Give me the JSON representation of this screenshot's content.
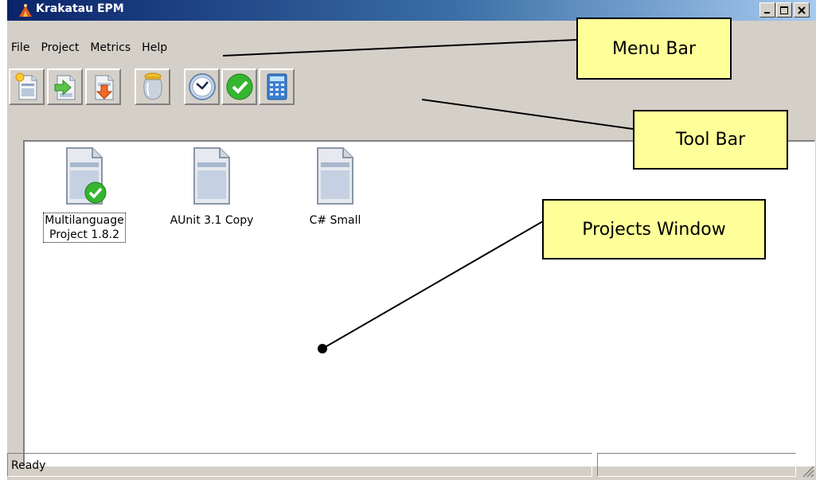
{
  "window": {
    "title": "Krakatau EPM"
  },
  "menubar": {
    "items": [
      {
        "label": "File"
      },
      {
        "label": "Project"
      },
      {
        "label": "Metrics"
      },
      {
        "label": "Help"
      }
    ]
  },
  "toolbar": {
    "buttons": [
      {
        "icon": "new-project-icon"
      },
      {
        "icon": "import-icon"
      },
      {
        "icon": "export-icon"
      },
      {
        "icon": "jar-icon"
      },
      {
        "icon": "clock-icon"
      },
      {
        "icon": "check-icon"
      },
      {
        "icon": "calculator-icon"
      }
    ]
  },
  "projects": {
    "items": [
      {
        "line1": "Multilanguage",
        "line2": "Project 1.8.2",
        "icon": "document-check-icon",
        "selected": true
      },
      {
        "line1": "AUnit 3.1 Copy",
        "line2": "",
        "icon": "document-icon",
        "selected": false
      },
      {
        "line1": "C# Small",
        "line2": "",
        "icon": "document-icon",
        "selected": false
      }
    ]
  },
  "statusbar": {
    "text": "Ready"
  },
  "callouts": {
    "menu_bar": "Menu Bar",
    "tool_bar": "Tool Bar",
    "projects_window": "Projects Window"
  },
  "colors": {
    "callout_fill": "#ffff99",
    "titlebar_start": "#0a246a",
    "window_face": "#d4d0c8"
  }
}
